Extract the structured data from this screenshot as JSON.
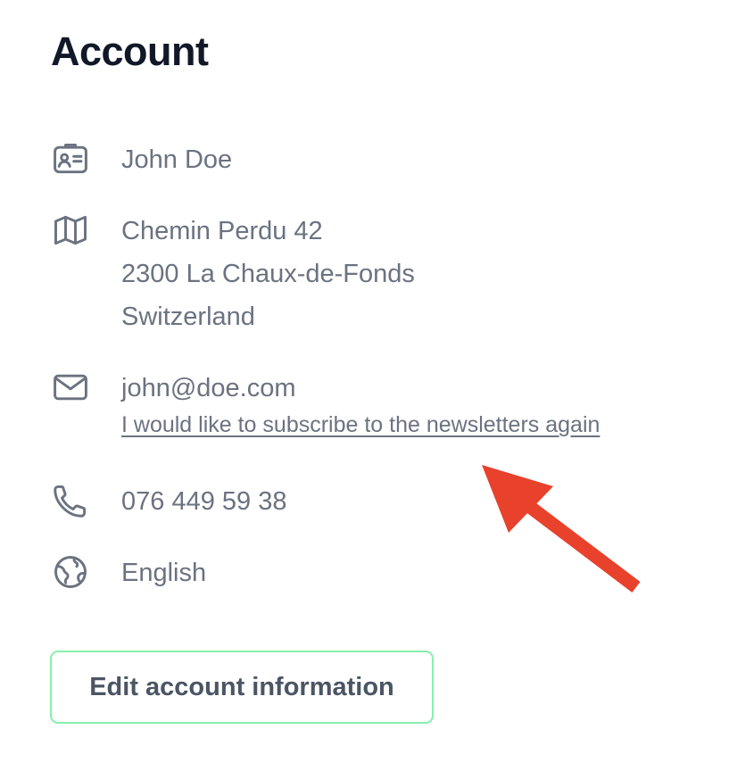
{
  "account": {
    "title": "Account",
    "name": "John Doe",
    "address": {
      "street": "Chemin Perdu 42",
      "city": "2300 La Chaux-de-Fonds",
      "country": "Switzerland"
    },
    "email": "john@doe.com",
    "newsletter_link": "I would like to subscribe to the newsletters again",
    "phone": "076 449 59 38",
    "language": "English",
    "edit_button_label": "Edit account information"
  },
  "icons": {
    "name": "id-card-icon",
    "address": "map-icon",
    "email": "envelope-icon",
    "phone": "phone-icon",
    "language": "globe-icon",
    "annotation": "red-arrow-icon"
  },
  "colors": {
    "title": "#111827",
    "text": "#6b7280",
    "button_border": "#86efac",
    "button_text": "#4b5563",
    "annotation_arrow": "#e8412c"
  }
}
